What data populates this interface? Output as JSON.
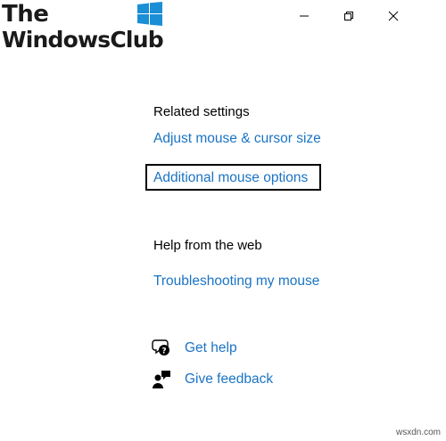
{
  "logo": {
    "line1": "The",
    "line2": "WindowsClub"
  },
  "window_controls": {
    "minimize": "minimize-icon",
    "restore": "restore-icon",
    "close": "close-icon"
  },
  "related_settings": {
    "title": "Related settings",
    "links": [
      "Adjust mouse & cursor size",
      "Additional mouse options"
    ]
  },
  "help_web": {
    "title": "Help from the web",
    "links": [
      "Troubleshooting my mouse"
    ]
  },
  "actions": [
    {
      "icon": "get-help-icon",
      "label": "Get help"
    },
    {
      "icon": "give-feedback-icon",
      "label": "Give feedback"
    }
  ],
  "watermark": "wsxdn.com",
  "colors": {
    "link": "#1a74c4",
    "logo_blue": "#1b8fd6"
  }
}
